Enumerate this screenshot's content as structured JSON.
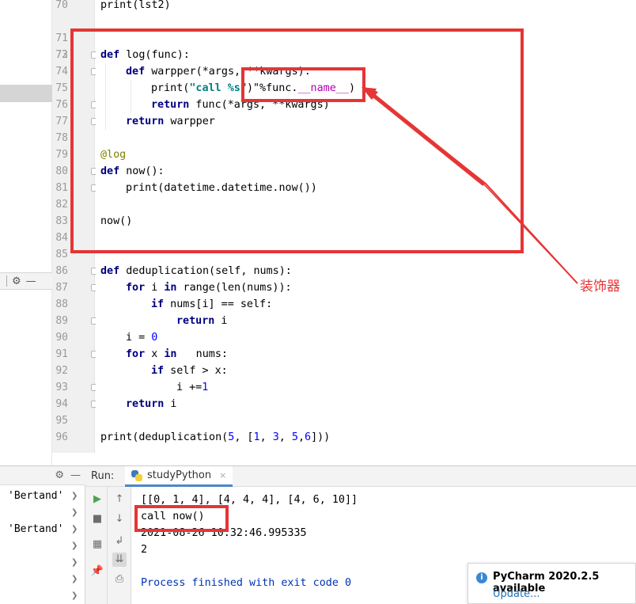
{
  "editor": {
    "line_numbers": [
      "70",
      "71",
      "72",
      "73",
      "74",
      "75",
      "76",
      "77",
      "78",
      "79",
      "80",
      "81",
      "82",
      "83",
      "84",
      "85",
      "86",
      "87",
      "88",
      "89",
      "90",
      "91",
      "92",
      "93",
      "94",
      "95",
      "96"
    ]
  },
  "code": {
    "l70_a": "print(lst2)",
    "l73_kw": "def",
    "l73_b": " log(func):",
    "l74_kw": "def",
    "l74_b": " warpper(*args, **kwargs):",
    "l75_a": "print(",
    "l75_str": "\"call %s\"",
    "l75_b": ")\"%func.",
    "l75_magic": "__name__",
    "l75_c": ")",
    "l76_kw": "return",
    "l76_b": " func(*args, **kwargs)",
    "l77_kw": "return",
    "l77_b": " warpper",
    "l79_dec": "@log",
    "l80_kw": "def",
    "l80_b": " now():",
    "l81_a": "print(datetime.datetime.now())",
    "l83_a": "now()",
    "l86_kw": "def",
    "l86_b": " deduplication(self, nums):",
    "l87_kw": "for",
    "l87_b": " i ",
    "l87_kw2": "in",
    "l87_c": " range(len(nums)):",
    "l88_kw": "if",
    "l88_b": " nums[i] == self:",
    "l89_kw": "return",
    "l89_b": " i",
    "l90_a": "i = ",
    "l90_num": "0",
    "l91_kw": "for",
    "l91_b": " x ",
    "l91_kw2": "in",
    "l91_c": "   nums:",
    "l92_kw": "if",
    "l92_b": " self > x:",
    "l93_a": "i +=",
    "l93_num": "1",
    "l94_kw": "return",
    "l94_b": " i",
    "l96_a": "print(deduplication(",
    "l96_n1": "5",
    "l96_b": ", [",
    "l96_n2": "1",
    "l96_c": ", ",
    "l96_n3": "3",
    "l96_d": ", ",
    "l96_n4": "5",
    "l96_e": ",",
    "l96_n5": "6",
    "l96_f": "]))"
  },
  "variables": {
    "item1": "'Bertand'",
    "item2": "'Bertand'"
  },
  "run_panel": {
    "label": "Run:",
    "tab_name": "studyPython",
    "close_glyph": "×"
  },
  "console": {
    "lines": [
      "[[0, 1, 4], [4, 4, 4], [4, 6, 10]]",
      "call now()",
      "2021-08-26 10:32:46.995335",
      "2",
      "",
      "Process finished with exit code 0"
    ]
  },
  "annotation": {
    "label": "装饰器",
    "color": "#e53535"
  },
  "notification": {
    "title": "PyCharm 2020.2.5 available",
    "link": "Update..."
  },
  "icons": {
    "gear": "⚙",
    "minimize": "—",
    "play": "▶",
    "stop": "■",
    "up": "↑",
    "down": "↓",
    "wrap": "↲",
    "scroll": "⇊",
    "print": "⎙",
    "pin": "📌",
    "layout": "▦",
    "info": "i"
  }
}
